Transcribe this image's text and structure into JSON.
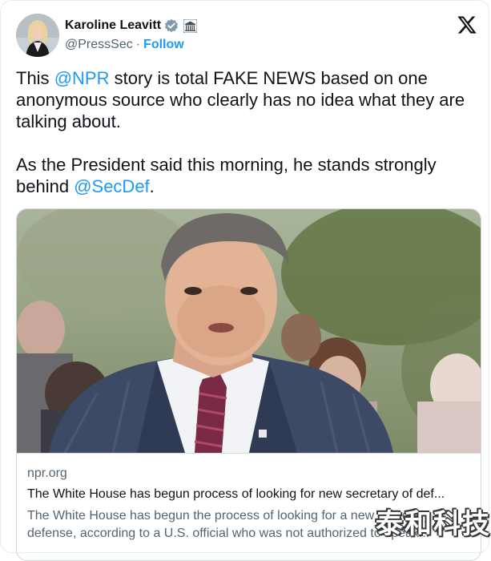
{
  "author": {
    "name": "Karoline Leavitt",
    "handle": "@PressSec",
    "separator": "·",
    "follow_label": "Follow",
    "verified_icon": "verified-badge-icon",
    "affiliation_icon": "white-house-icon"
  },
  "platform_icon": "x-logo-icon",
  "tweet": {
    "p1_a": "This ",
    "p1_mention": "@NPR",
    "p1_b": " story is total FAKE NEWS based on one anonymous source who clearly has no idea what they are talking about.",
    "p2_a": "As the President said this morning, he stands strongly behind ",
    "p2_mention": "@SecDef",
    "p2_b": "."
  },
  "link_card": {
    "domain": "npr.org",
    "headline": "The White House has begun process of looking for new secretary of def...",
    "description": "The White House has begun the process of looking for a new secretary of defense, according to a U.S. official who was not authorized to speak..."
  },
  "watermark": "泰和科技",
  "colors": {
    "accent": "#1d9bf0",
    "text": "#0f1419",
    "muted": "#536471",
    "verified": "#829aab"
  }
}
